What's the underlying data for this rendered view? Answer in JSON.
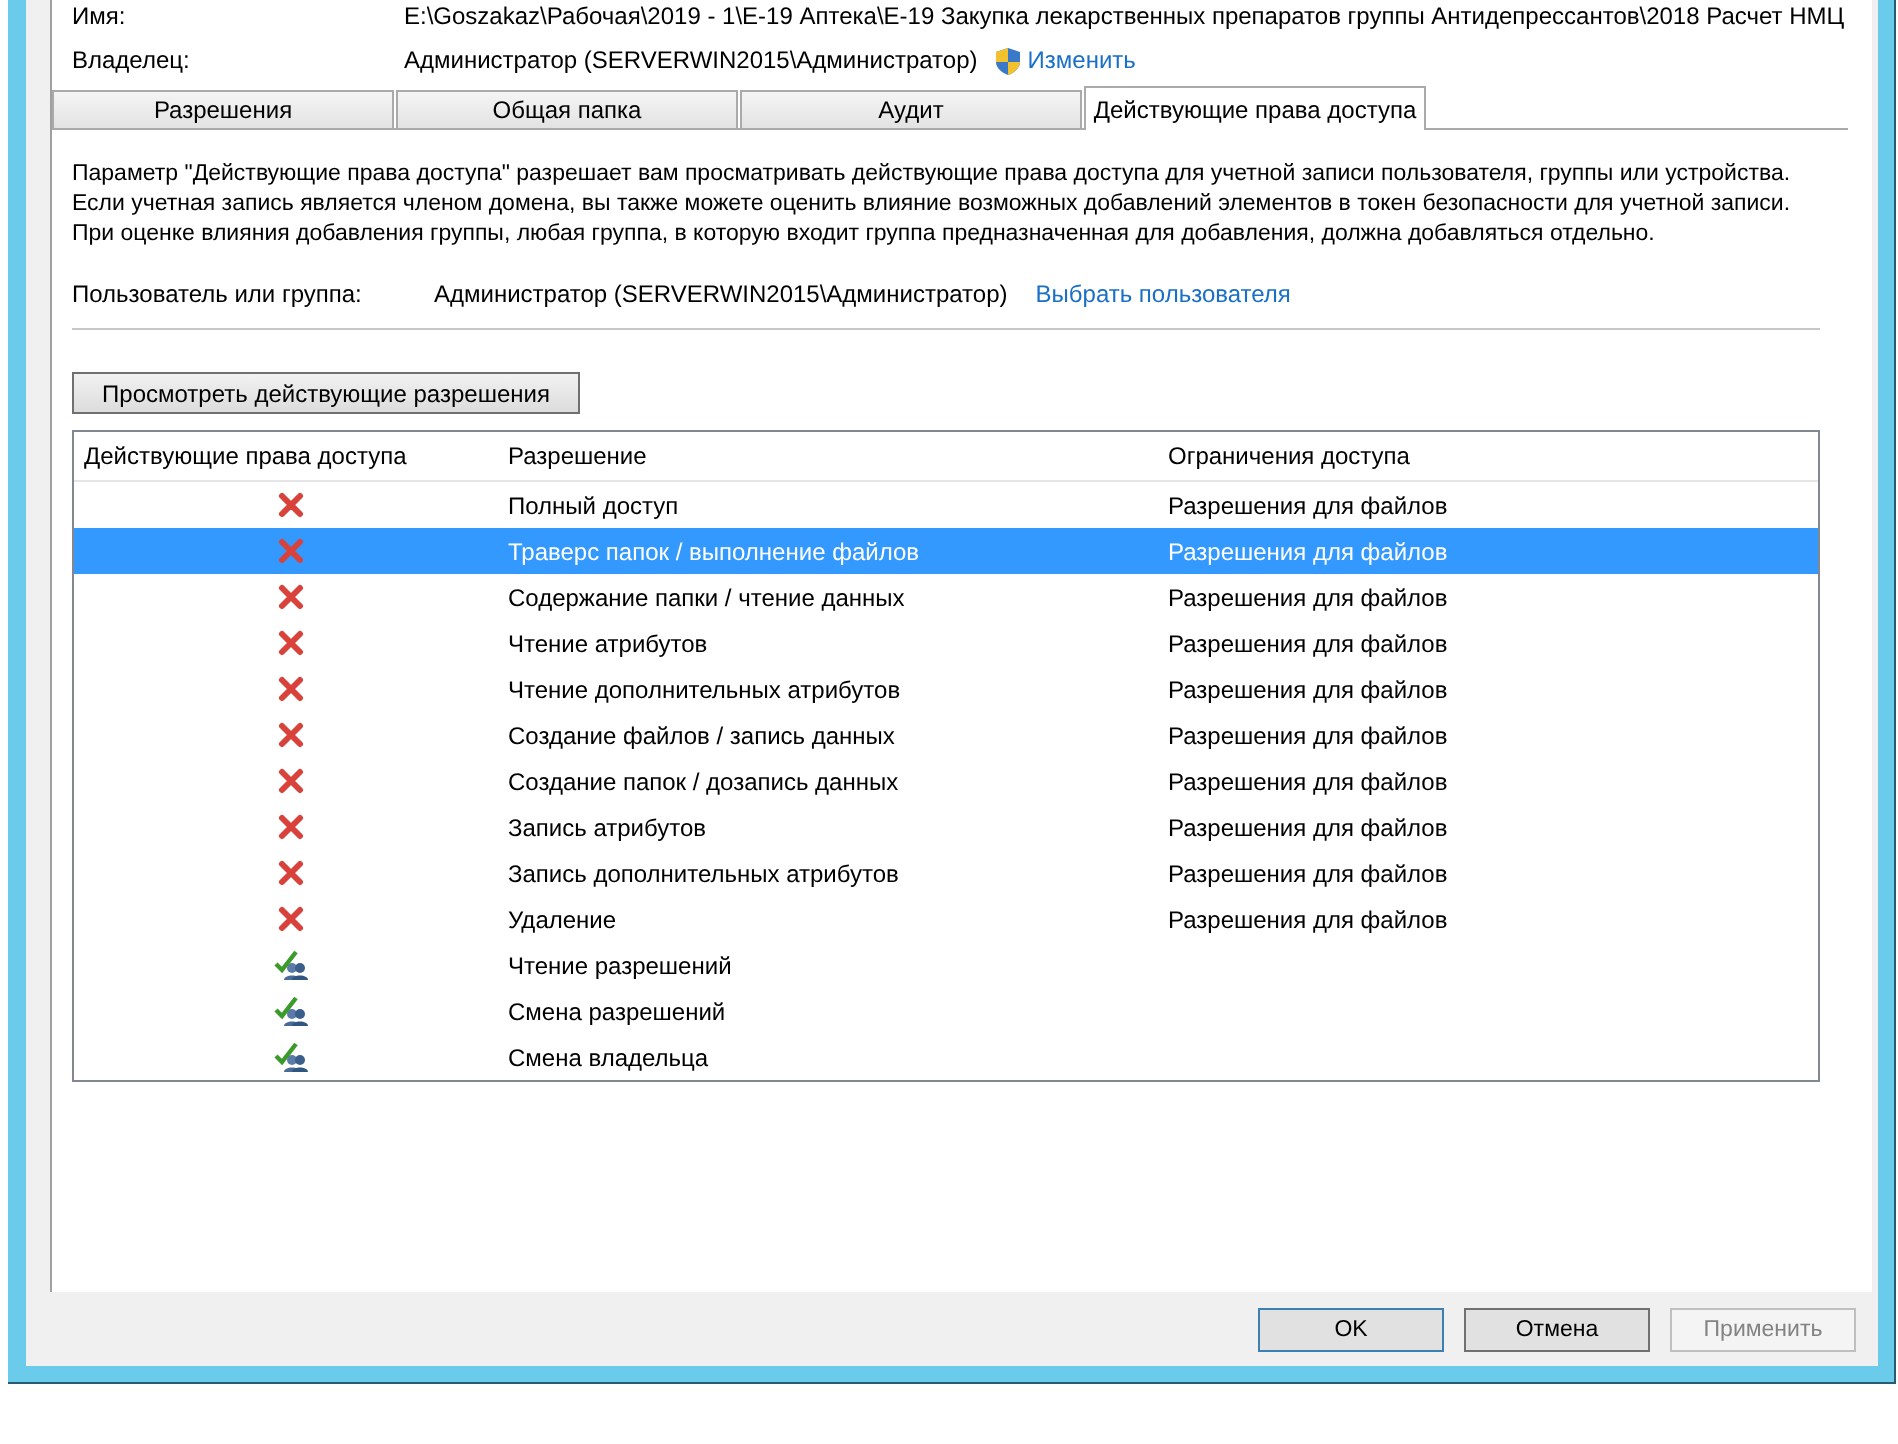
{
  "name_label": "Имя:",
  "name_value": "E:\\Goszakaz\\Рабочая\\2019 - 1\\Е-19 Аптека\\Е-19 Закупка лекарственных препаратов группы Антидепрессантов\\2018 Расчет НМЦ",
  "owner_label": "Владелец:",
  "owner_value": "Администратор (SERVERWIN2015\\Администратор)",
  "owner_change_link": "Изменить",
  "tabs": [
    {
      "label": "Разрешения",
      "selected": false
    },
    {
      "label": "Общая папка",
      "selected": false
    },
    {
      "label": "Аудит",
      "selected": false
    },
    {
      "label": "Действующие права доступа",
      "selected": true
    }
  ],
  "description": "Параметр \"Действующие права доступа\" разрешает вам просматривать действующие права доступа для учетной записи пользователя, группы или устройства. Если учетная запись является членом домена, вы также можете оценить влияние возможных добавлений элементов в токен безопасности для учетной записи. При оценке влияния добавления группы, любая группа, в которую входит группа предназначенная для добавления, должна добавляться отдельно.",
  "user_label": "Пользователь или группа:",
  "user_value": "Администратор (SERVERWIN2015\\Администратор)",
  "select_user_link": "Выбрать пользователя",
  "view_button": "Просмотреть действующие разрешения",
  "table": {
    "columns": [
      "Действующие права доступа",
      "Разрешение",
      "Ограничения доступа"
    ],
    "rows": [
      {
        "allowed": false,
        "selected": false,
        "permission": "Полный доступ",
        "limit": "Разрешения для файлов"
      },
      {
        "allowed": false,
        "selected": true,
        "permission": "Траверс папок / выполнение файлов",
        "limit": "Разрешения для файлов"
      },
      {
        "allowed": false,
        "selected": false,
        "permission": "Содержание папки / чтение данных",
        "limit": "Разрешения для файлов"
      },
      {
        "allowed": false,
        "selected": false,
        "permission": "Чтение атрибутов",
        "limit": "Разрешения для файлов"
      },
      {
        "allowed": false,
        "selected": false,
        "permission": "Чтение дополнительных атрибутов",
        "limit": "Разрешения для файлов"
      },
      {
        "allowed": false,
        "selected": false,
        "permission": "Создание файлов / запись данных",
        "limit": "Разрешения для файлов"
      },
      {
        "allowed": false,
        "selected": false,
        "permission": "Создание папок / дозапись данных",
        "limit": "Разрешения для файлов"
      },
      {
        "allowed": false,
        "selected": false,
        "permission": "Запись атрибутов",
        "limit": "Разрешения для файлов"
      },
      {
        "allowed": false,
        "selected": false,
        "permission": "Запись дополнительных атрибутов",
        "limit": "Разрешения для файлов"
      },
      {
        "allowed": false,
        "selected": false,
        "permission": "Удаление",
        "limit": "Разрешения для файлов"
      },
      {
        "allowed": true,
        "selected": false,
        "permission": "Чтение разрешений"
      },
      {
        "allowed": true,
        "selected": false,
        "permission": "Смена разрешений"
      },
      {
        "allowed": true,
        "selected": false,
        "permission": "Смена владельца"
      }
    ]
  },
  "buttons": [
    {
      "label": "OK",
      "kind": "default",
      "disabled": false
    },
    {
      "label": "Отмена",
      "kind": "normal",
      "disabled": false
    },
    {
      "label": "Применить",
      "kind": "normal",
      "disabled": true
    }
  ]
}
